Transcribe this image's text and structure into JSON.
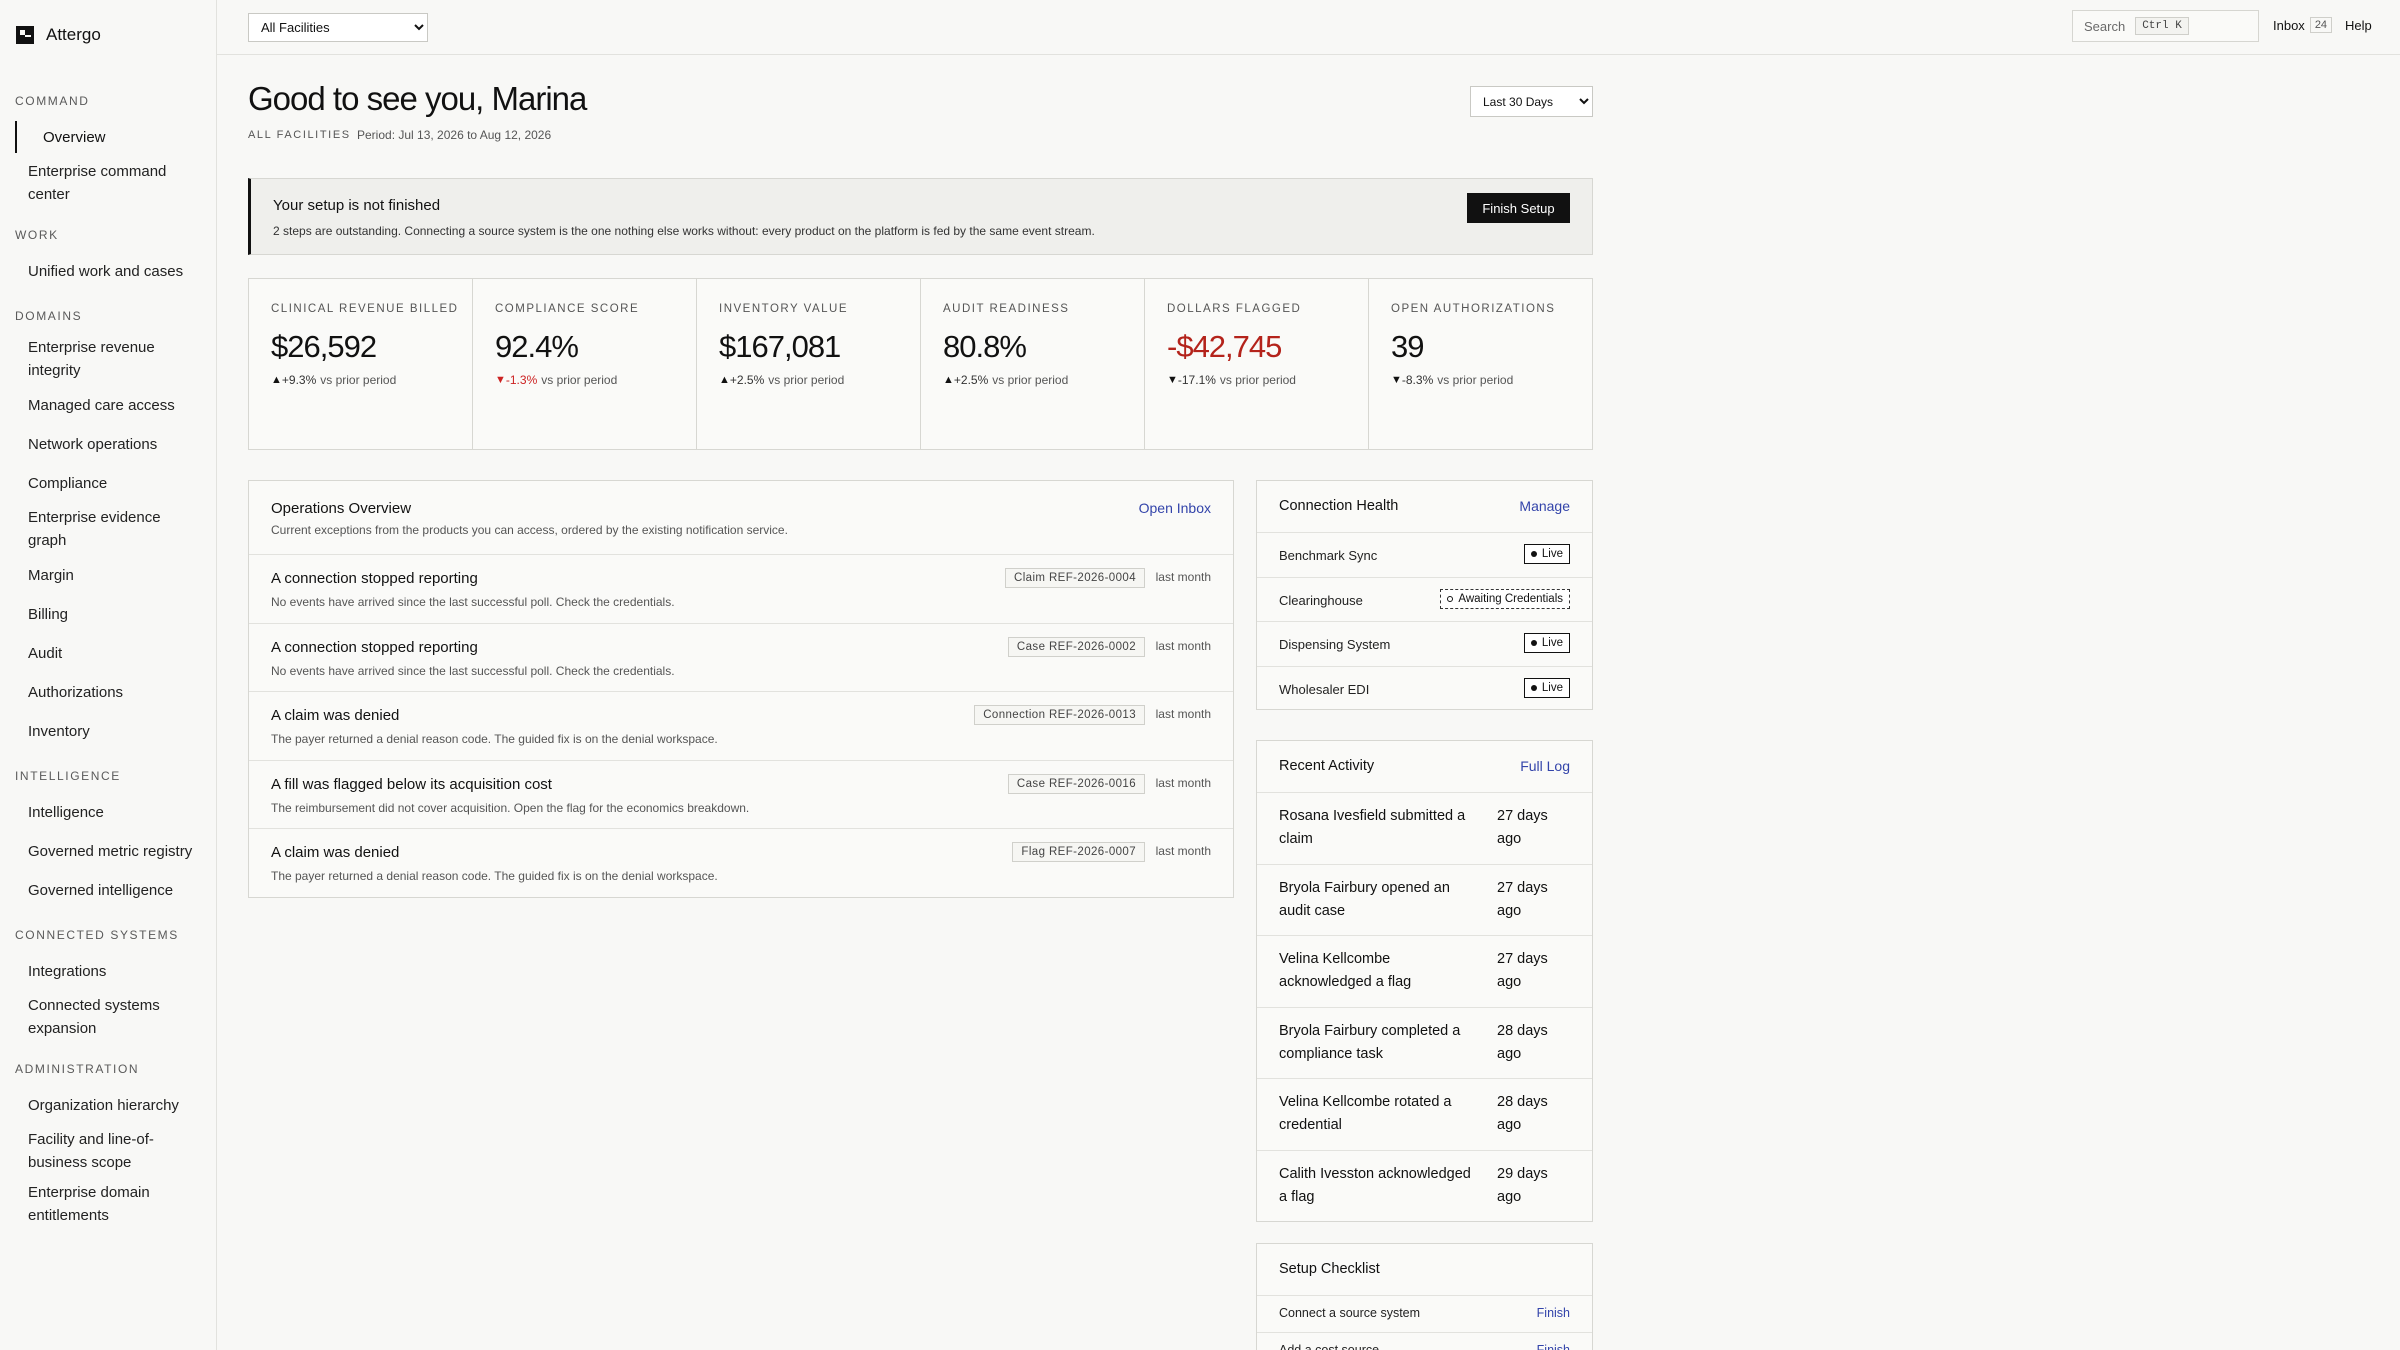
{
  "app": {
    "name": "Attergo"
  },
  "sidebar": {
    "sections": [
      {
        "label": "COMMAND",
        "items": [
          {
            "label": "Overview",
            "active": true
          },
          {
            "label": "Enterprise command center"
          }
        ]
      },
      {
        "label": "WORK",
        "items": [
          {
            "label": "Unified work and cases"
          }
        ]
      },
      {
        "label": "DOMAINS",
        "items": [
          {
            "label": "Enterprise revenue integrity"
          },
          {
            "label": "Managed care access"
          },
          {
            "label": "Network operations"
          },
          {
            "label": "Compliance"
          },
          {
            "label": "Enterprise evidence graph"
          },
          {
            "label": "Margin"
          },
          {
            "label": "Billing"
          },
          {
            "label": "Audit"
          },
          {
            "label": "Authorizations"
          },
          {
            "label": "Inventory"
          }
        ]
      },
      {
        "label": "INTELLIGENCE",
        "items": [
          {
            "label": "Intelligence"
          },
          {
            "label": "Governed metric registry"
          },
          {
            "label": "Governed intelligence"
          }
        ]
      },
      {
        "label": "CONNECTED SYSTEMS",
        "items": [
          {
            "label": "Integrations"
          },
          {
            "label": "Connected systems expansion"
          }
        ]
      },
      {
        "label": "ADMINISTRATION",
        "items": [
          {
            "label": "Organization hierarchy"
          },
          {
            "label": "Facility and line-of-business scope"
          },
          {
            "label": "Enterprise domain entitlements"
          }
        ]
      }
    ]
  },
  "topbar": {
    "facility_select": "All Facilities",
    "search_label": "Search",
    "search_shortcut": "Ctrl K",
    "inbox_label": "Inbox",
    "inbox_count": "24",
    "help_label": "Help"
  },
  "header": {
    "greeting": "Good to see you, Marina",
    "scope": "ALL FACILITIES",
    "period": "Period: Jul 13, 2026 to Aug 12, 2026",
    "range_select": "Last 30 Days"
  },
  "setup_banner": {
    "title": "Your setup is not finished",
    "description": "2 steps are outstanding. Connecting a source system is the one nothing else works without: every product on the platform is fed by the same event stream.",
    "button": "Finish Setup"
  },
  "kpis": [
    {
      "label": "CLINICAL REVENUE BILLED",
      "value": "$26,592",
      "arrow": "▲",
      "delta": "+9.3%",
      "suffix": "vs prior period",
      "negative": false,
      "delta_red": false
    },
    {
      "label": "COMPLIANCE SCORE",
      "value": "92.4%",
      "arrow": "▼",
      "delta": "-1.3%",
      "suffix": "vs prior period",
      "negative": false,
      "delta_red": true
    },
    {
      "label": "INVENTORY VALUE",
      "value": "$167,081",
      "arrow": "▲",
      "delta": "+2.5%",
      "suffix": "vs prior period",
      "negative": false,
      "delta_red": false
    },
    {
      "label": "AUDIT READINESS",
      "value": "80.8%",
      "arrow": "▲",
      "delta": "+2.5%",
      "suffix": "vs prior period",
      "negative": false,
      "delta_red": false
    },
    {
      "label": "DOLLARS FLAGGED",
      "value": "-$42,745",
      "arrow": "▼",
      "delta": "-17.1%",
      "suffix": "vs prior period",
      "negative": true,
      "delta_red": false
    },
    {
      "label": "OPEN AUTHORIZATIONS",
      "value": "39",
      "arrow": "▼",
      "delta": "-8.3%",
      "suffix": "vs prior period",
      "negative": false,
      "delta_red": false
    }
  ],
  "operations": {
    "title": "Operations Overview",
    "subtitle": "Current exceptions from the products you can access, ordered by the existing notification service.",
    "link": "Open Inbox",
    "rows": [
      {
        "title": "A connection stopped reporting",
        "desc": "No events have arrived since the last successful poll. Check the credentials.",
        "ref": "Claim REF-2026-0004",
        "time": "last month"
      },
      {
        "title": "A connection stopped reporting",
        "desc": "No events have arrived since the last successful poll. Check the credentials.",
        "ref": "Case REF-2026-0002",
        "time": "last month"
      },
      {
        "title": "A claim was denied",
        "desc": "The payer returned a denial reason code. The guided fix is on the denial workspace.",
        "ref": "Connection REF-2026-0013",
        "time": "last month"
      },
      {
        "title": "A fill was flagged below its acquisition cost",
        "desc": "The reimbursement did not cover acquisition. Open the flag for the economics breakdown.",
        "ref": "Case REF-2026-0016",
        "time": "last month"
      },
      {
        "title": "A claim was denied",
        "desc": "The payer returned a denial reason code. The guided fix is on the denial workspace.",
        "ref": "Flag REF-2026-0007",
        "time": "last month"
      }
    ]
  },
  "connection_health": {
    "title": "Connection Health",
    "link": "Manage",
    "rows": [
      {
        "name": "Benchmark Sync",
        "status": "Live",
        "pending": false
      },
      {
        "name": "Clearinghouse",
        "status": "Awaiting Credentials",
        "pending": true
      },
      {
        "name": "Dispensing System",
        "status": "Live",
        "pending": false
      },
      {
        "name": "Wholesaler EDI",
        "status": "Live",
        "pending": false
      }
    ]
  },
  "recent_activity": {
    "title": "Recent Activity",
    "link": "Full Log",
    "rows": [
      {
        "text": "Rosana Ivesfield submitted a claim",
        "time": "27 days ago"
      },
      {
        "text": "Bryola Fairbury opened an audit case",
        "time": "27 days ago"
      },
      {
        "text": "Velina Kellcombe acknowledged a flag",
        "time": "27 days ago"
      },
      {
        "text": "Bryola Fairbury completed a compliance task",
        "time": "28 days ago"
      },
      {
        "text": "Velina Kellcombe rotated a credential",
        "time": "28 days ago"
      },
      {
        "text": "Calith Ivesston acknowledged a flag",
        "time": "29 days ago"
      }
    ]
  },
  "setup_checklist": {
    "title": "Setup Checklist",
    "rows": [
      {
        "label": "Connect a source system",
        "action": "Finish"
      },
      {
        "label": "Add a cost source",
        "action": "Finish"
      }
    ]
  }
}
